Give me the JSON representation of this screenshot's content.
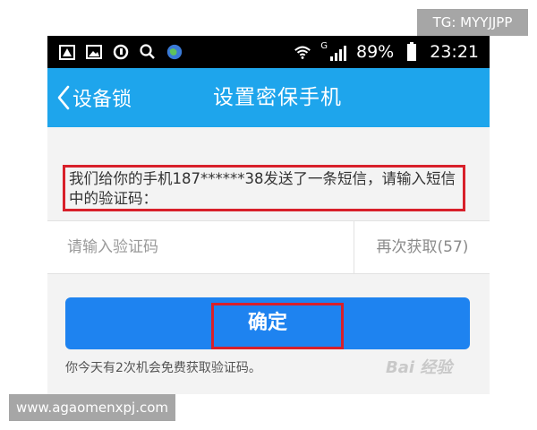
{
  "watermarks": {
    "tg": "TG: MYYJJPP",
    "url": "www.agaomenxpj.com",
    "baidu": "Bai 经验"
  },
  "status_bar": {
    "network_type": "G",
    "battery_percent": "89%",
    "time": "23:21"
  },
  "nav": {
    "back_label": "设备锁",
    "title": "设置密保手机"
  },
  "message": "我们给你的手机187******38发送了一条短信，请输入短信中的验证码：",
  "verification": {
    "placeholder": "请输入验证码",
    "value": "",
    "resend_label": "再次获取(57)"
  },
  "confirm_label": "确定",
  "hint": "你今天有2次机会免费获取验证码。",
  "colors": {
    "nav_bar": "#1ea5ec",
    "confirm_button": "#1e83f0",
    "highlight": "#d8202a"
  }
}
